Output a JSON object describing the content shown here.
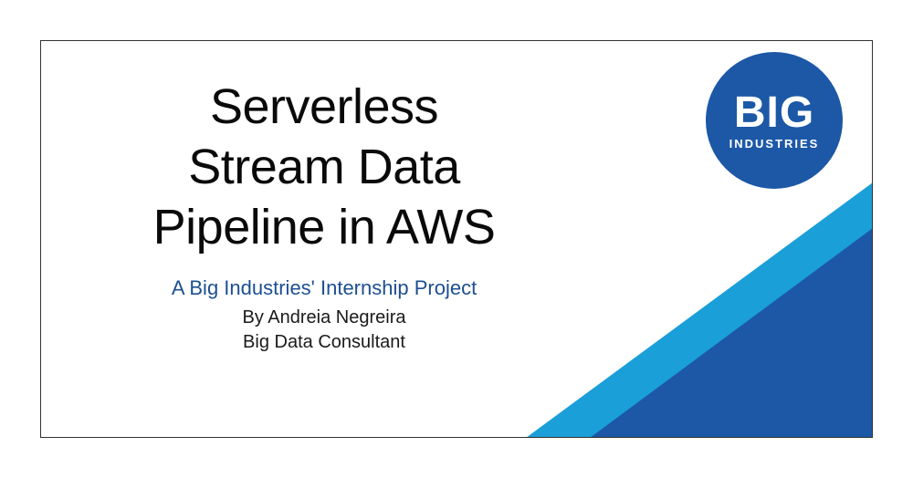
{
  "slide": {
    "title": "Serverless Stream Data Pipeline in AWS",
    "title_lines": [
      "Serverless",
      "Stream Data",
      "Pipeline in AWS"
    ],
    "subtitle": "A Big Industries' Internship Project",
    "author": "By Andreia Negreira",
    "role": "Big Data Consultant"
  },
  "logo": {
    "main": "BIG",
    "sub": "INDUSTRIES"
  },
  "colors": {
    "brand_dark": "#1c58a6",
    "brand_light": "#1a9fd9",
    "subtitle": "#1d4f91"
  }
}
